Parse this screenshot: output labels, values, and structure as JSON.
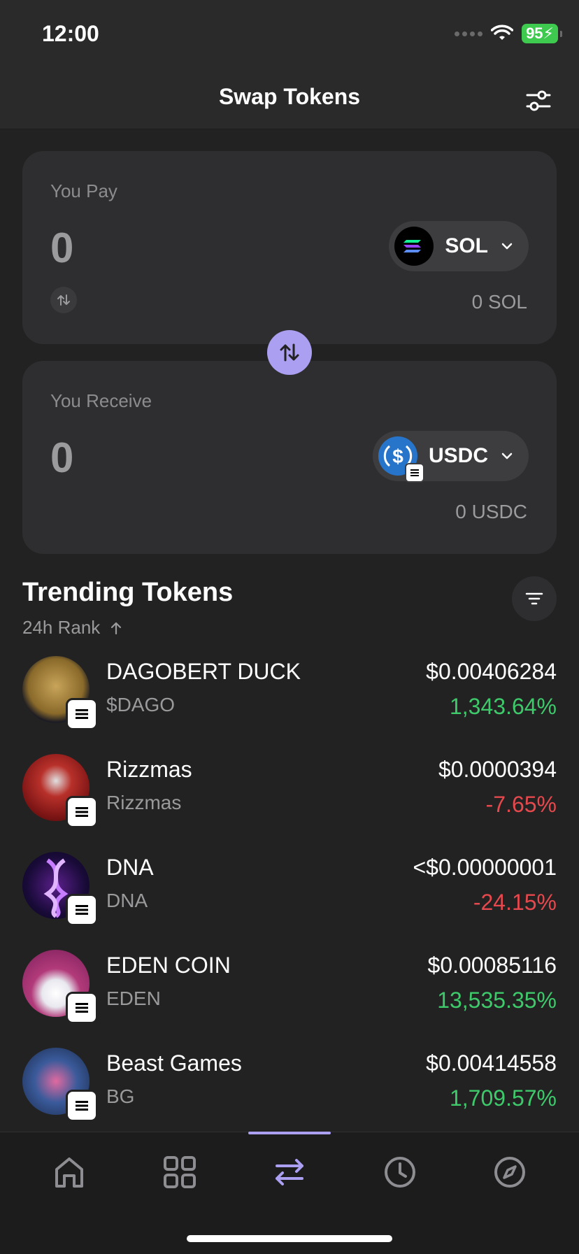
{
  "status": {
    "time": "12:00",
    "battery": "95"
  },
  "header": {
    "title": "Swap Tokens"
  },
  "pay": {
    "label": "You Pay",
    "amount": "0",
    "token": "SOL",
    "balance": "0 SOL"
  },
  "receive": {
    "label": "You Receive",
    "amount": "0",
    "token": "USDC",
    "balance": "0 USDC"
  },
  "trending": {
    "title": "Trending Tokens",
    "sort_label": "24h Rank",
    "tokens": [
      {
        "name": "DAGOBERT DUCK",
        "symbol": "$DAGO",
        "price": "$0.00406284",
        "change": "1,343.64%",
        "direction": "up"
      },
      {
        "name": "Rizzmas",
        "symbol": "Rizzmas",
        "price": "$0.0000394",
        "change": "-7.65%",
        "direction": "down"
      },
      {
        "name": "DNA",
        "symbol": "DNA",
        "price": "<$0.00000001",
        "change": "-24.15%",
        "direction": "down"
      },
      {
        "name": "EDEN COIN",
        "symbol": "EDEN",
        "price": "$0.00085116",
        "change": "13,535.35%",
        "direction": "up"
      },
      {
        "name": "Beast Games",
        "symbol": "BG",
        "price": "$0.00414558",
        "change": "1,709.57%",
        "direction": "up"
      }
    ]
  },
  "tabs": [
    {
      "icon": "home-icon",
      "active": false
    },
    {
      "icon": "grid-icon",
      "active": false
    },
    {
      "icon": "swap-icon",
      "active": true
    },
    {
      "icon": "clock-icon",
      "active": false
    },
    {
      "icon": "compass-icon",
      "active": false
    }
  ],
  "colors": {
    "accent": "#ab9ff2",
    "positive": "#3ec96b",
    "negative": "#e5484d",
    "background": "#222222",
    "card": "#2e2e30"
  }
}
